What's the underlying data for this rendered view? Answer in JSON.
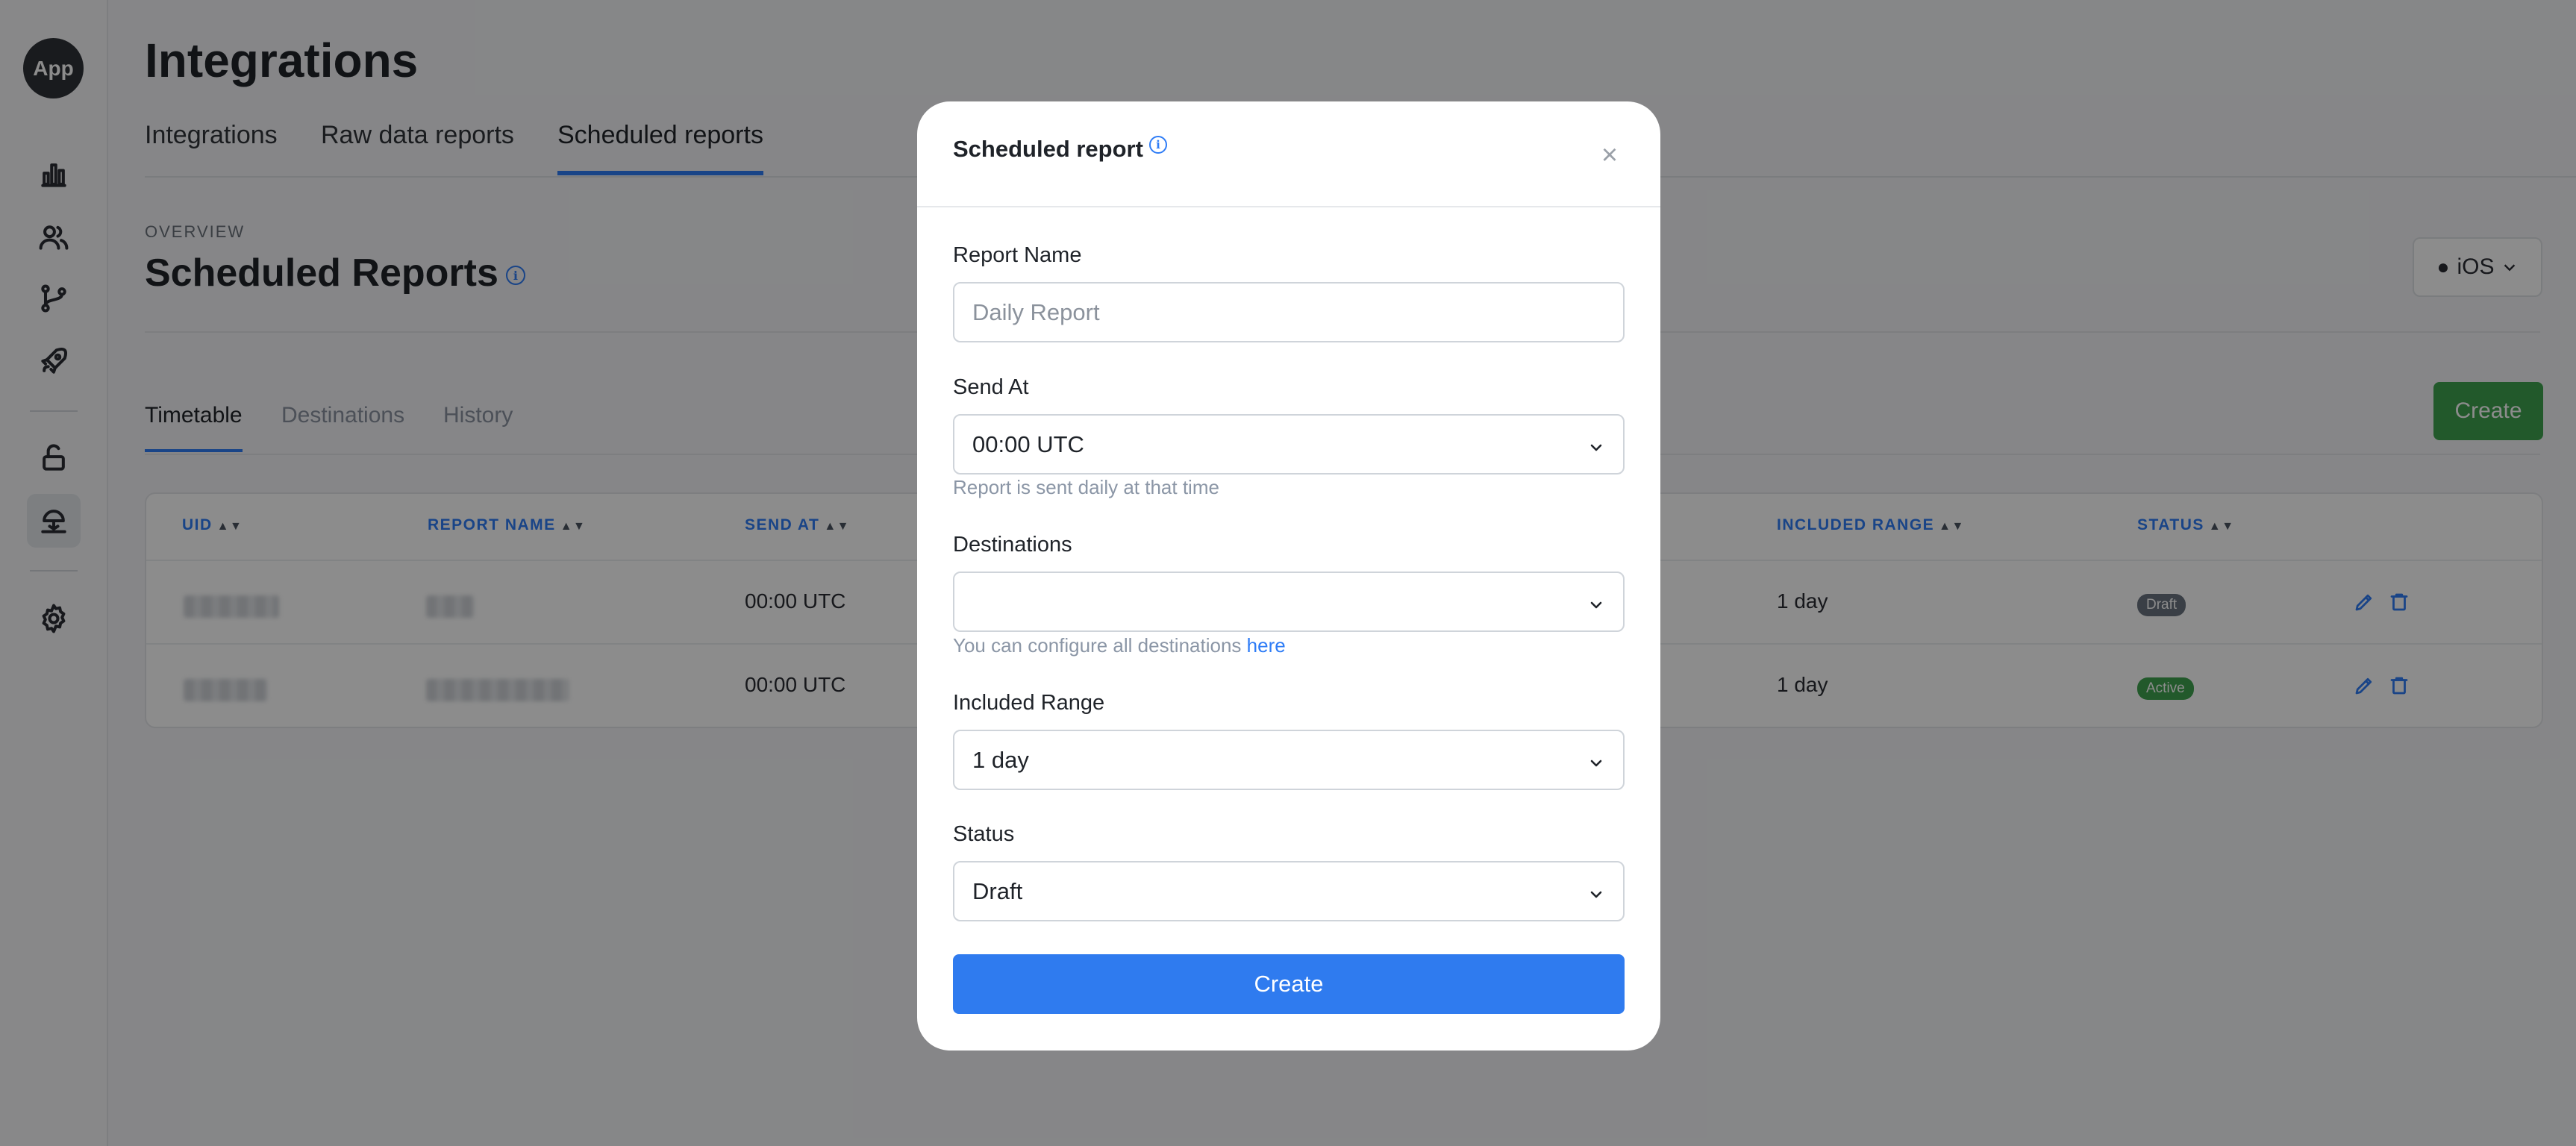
{
  "sidebar": {
    "logo": "App",
    "icons": [
      "bar-chart-icon",
      "users-icon",
      "branch-icon",
      "rocket-icon",
      "unlock-icon",
      "landing-icon",
      "gear-icon"
    ]
  },
  "page": {
    "title": "Integrations",
    "tabs": [
      "Integrations",
      "Raw data reports",
      "Scheduled reports"
    ],
    "active_tab": "Scheduled reports",
    "overview_label": "OVERVIEW",
    "section_title": "Scheduled Reports",
    "platform": "iOS",
    "subtabs": [
      "Timetable",
      "Destinations",
      "History"
    ],
    "active_subtab": "Timetable",
    "create_label": "Create"
  },
  "table": {
    "columns": {
      "uid": "UID",
      "report_name": "REPORT NAME",
      "send_at": "SEND AT",
      "included_range": "INCLUDED RANGE",
      "status": "STATUS"
    },
    "rows": [
      {
        "send_at": "00:00 UTC",
        "included_range": "1 day",
        "status": "Draft"
      },
      {
        "send_at": "00:00 UTC",
        "included_range": "1 day",
        "status": "Active"
      }
    ]
  },
  "modal": {
    "title": "Scheduled report",
    "report_name_label": "Report Name",
    "report_name_placeholder": "Daily Report",
    "send_at_label": "Send At",
    "send_at_value": "00:00 UTC",
    "send_at_hint": "Report is sent daily at that time",
    "destinations_label": "Destinations",
    "destinations_value": "",
    "destinations_hint": "You can configure all destinations ",
    "destinations_link": "here",
    "range_label": "Included Range",
    "range_value": "1 day",
    "status_label": "Status",
    "status_value": "Draft",
    "create_label": "Create"
  },
  "colors": {
    "accent": "#2e7cf6",
    "success": "#3ea34f",
    "overlay": "rgba(0,0,0,0.45)"
  }
}
